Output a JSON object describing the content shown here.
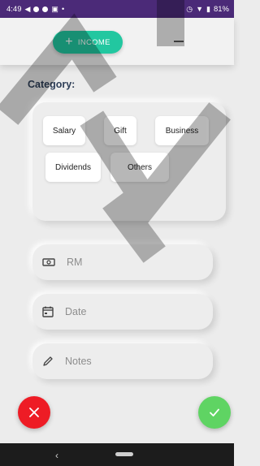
{
  "status_bar": {
    "time": "4:49",
    "battery": "81%"
  },
  "header": {
    "income_label": "INCOME"
  },
  "category": {
    "label": "Category:",
    "options": [
      "Salary",
      "Gift",
      "Business",
      "Dividends",
      "Others"
    ]
  },
  "fields": {
    "amount_placeholder": "RM",
    "date_placeholder": "Date",
    "notes_placeholder": "Notes"
  },
  "icons": {
    "amount": "cash-icon",
    "date": "calendar-icon",
    "notes": "pencil-icon",
    "cancel": "close-icon",
    "confirm": "check-icon"
  },
  "colors": {
    "income_button": "#22c7a0",
    "cancel_button": "#ee1c25",
    "confirm_button": "#5fd463",
    "category_label": "#2d3e57",
    "status_bar": "#4b2a78"
  }
}
